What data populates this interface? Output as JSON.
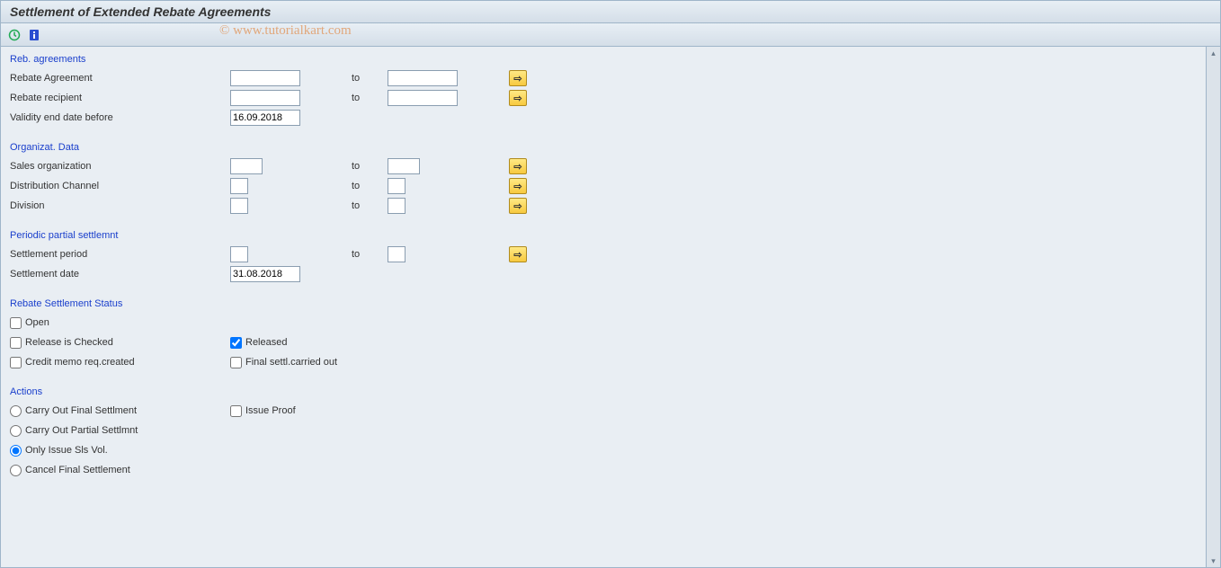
{
  "title": "Settlement of Extended Rebate Agreements",
  "watermark": "© www.tutorialkart.com",
  "sections": {
    "reb": {
      "title": "Reb. agreements",
      "rows": {
        "agreement": {
          "label": "Rebate Agreement",
          "to": "to"
        },
        "recipient": {
          "label": "Rebate recipient",
          "to": "to"
        },
        "validity": {
          "label": "Validity end date before",
          "value": "16.09.2018"
        }
      }
    },
    "org": {
      "title": "Organizat. Data",
      "rows": {
        "salesorg": {
          "label": "Sales organization",
          "to": "to"
        },
        "distch": {
          "label": "Distribution Channel",
          "to": "to"
        },
        "division": {
          "label": "Division",
          "to": "to"
        }
      }
    },
    "periodic": {
      "title": "Periodic partial settlemnt",
      "rows": {
        "period": {
          "label": "Settlement period",
          "to": "to"
        },
        "date": {
          "label": "Settlement date",
          "value": "31.08.2018"
        }
      }
    },
    "status": {
      "title": "Rebate Settlement Status",
      "open": "Open",
      "release_checked": "Release is Checked",
      "released": "Released",
      "credit_memo": "Credit memo req.created",
      "final_settl": "Final settl.carried out"
    },
    "actions": {
      "title": "Actions",
      "final": "Carry Out Final Settlment",
      "issue_proof": "Issue Proof",
      "partial": "Carry Out Partial Settlmnt",
      "only_sls": "Only Issue Sls Vol.",
      "cancel": "Cancel Final Settlement"
    }
  }
}
